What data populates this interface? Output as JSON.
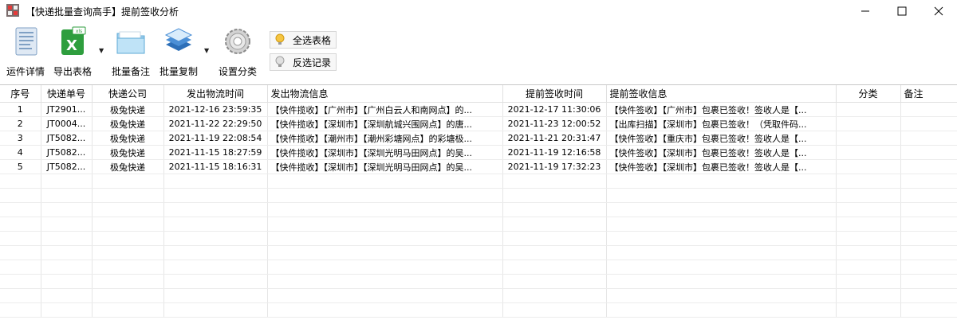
{
  "window": {
    "title": "【快递批量查询高手】提前签收分析",
    "minimize_icon": "minimize-icon",
    "maximize_icon": "maximize-icon",
    "close_icon": "close-icon"
  },
  "toolbar": {
    "buttons": [
      {
        "label": "运件详情",
        "icon": "document-icon"
      },
      {
        "label": "导出表格",
        "icon": "excel-icon"
      },
      {
        "label": "批量备注",
        "icon": "folder-icon"
      },
      {
        "label": "批量复制",
        "icon": "copy-stack-icon"
      },
      {
        "label": "设置分类",
        "icon": "gear-icon"
      }
    ],
    "select_all": "全选表格",
    "invert_select": "反选记录"
  },
  "table": {
    "columns": [
      "序号",
      "快递单号",
      "快递公司",
      "发出物流时间",
      "发出物流信息",
      "提前签收时间",
      "提前签收信息",
      "分类",
      "备注"
    ],
    "rows": [
      [
        "1",
        "JT2901...",
        "极兔快递",
        "2021-12-16 23:59:35",
        "【快件揽收】【广州市】【广州白云人和南网点】的...",
        "2021-12-17 11:30:06",
        "【快件签收】【广州市】包裹已签收！签收人是【...",
        "",
        ""
      ],
      [
        "2",
        "JT0004...",
        "极兔快递",
        "2021-11-22 22:29:50",
        "【快件揽收】【深圳市】【深圳航城兴围网点】的唐...",
        "2021-11-23 12:00:52",
        "【出库扫描】【深圳市】包裹已签收！（凭取件码...",
        "",
        ""
      ],
      [
        "3",
        "JT5082...",
        "极兔快递",
        "2021-11-19 22:08:54",
        "【快件揽收】【潮州市】【潮州彩塘网点】的彩塘极...",
        "2021-11-21 20:31:47",
        "【快件签收】【重庆市】包裹已签收！签收人是【...",
        "",
        ""
      ],
      [
        "4",
        "JT5082...",
        "极兔快递",
        "2021-11-15 18:27:59",
        "【快件揽收】【深圳市】【深圳光明马田网点】的吴...",
        "2021-11-19 12:16:58",
        "【快件签收】【深圳市】包裹已签收！签收人是【...",
        "",
        ""
      ],
      [
        "5",
        "JT5082...",
        "极兔快递",
        "2021-11-15 18:16:31",
        "【快件揽收】【深圳市】【深圳光明马田网点】的吴...",
        "2021-11-19 17:32:23",
        "【快件签收】【深圳市】包裹已签收！签收人是【...",
        "",
        ""
      ]
    ],
    "empty_rows": 10
  }
}
